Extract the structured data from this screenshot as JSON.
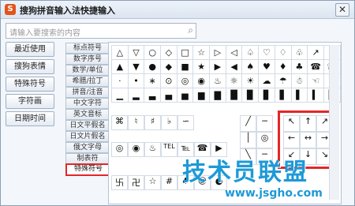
{
  "window": {
    "title": "搜狗拼音输入法快捷输入",
    "close_label": "✕",
    "logo_letter": "S"
  },
  "search": {
    "placeholder": "请输入要搜索的内容"
  },
  "left_buttons": [
    "最近使用",
    "搜狗表情",
    "特殊符号",
    "字符画",
    "日期时间"
  ],
  "categories": [
    "标点符号",
    "数字序号",
    "数学/单位",
    "希腊/拉丁",
    "拼音/注音",
    "中文字符",
    "英文音标",
    "日文平假名",
    "日文片假名",
    "俄文字母",
    "制表符",
    "特殊符号"
  ],
  "selected_category": "特殊符号",
  "symbols_top": [
    [
      "△",
      "▽",
      "○",
      "◇",
      "□",
      "☆",
      "▷",
      "◁",
      "♤",
      "♡",
      "♢",
      "♧",
      "↗",
      "◈"
    ],
    [
      "▲",
      "▼",
      "●",
      "◆",
      "■",
      "★",
      "▶",
      "◀",
      "♠",
      "♥",
      "♦",
      "♣",
      "☎",
      "☏"
    ],
    [
      "·",
      "•",
      "∗",
      "⊙",
      "◎",
      "◉",
      "♨",
      "☼",
      "☀",
      "☁",
      "☂",
      "☃",
      "☜",
      "☞"
    ],
    [
      "▁",
      "▂",
      "▃",
      "▄",
      "▅",
      "▆",
      "▇",
      "█",
      "▉",
      "▊",
      "▋",
      "▌",
      "▍",
      "▎"
    ]
  ],
  "symbols_mid": [
    [
      "⌘",
      "♮",
      "♯",
      "♭",
      "∽"
    ],
    [
      "◎",
      "◉",
      "♨",
      "TEL",
      "℡",
      "☎",
      "▶"
    ],
    [
      "卐",
      "卍",
      "☆",
      "#",
      "♣",
      "☺",
      "●"
    ]
  ],
  "arrows": [
    "↖",
    "↑",
    "↗",
    "←",
    "↔",
    "→",
    "↙",
    "↓",
    "↘"
  ],
  "watermark": {
    "text": "技术员联盟",
    "url": "www.jsgho.com"
  }
}
